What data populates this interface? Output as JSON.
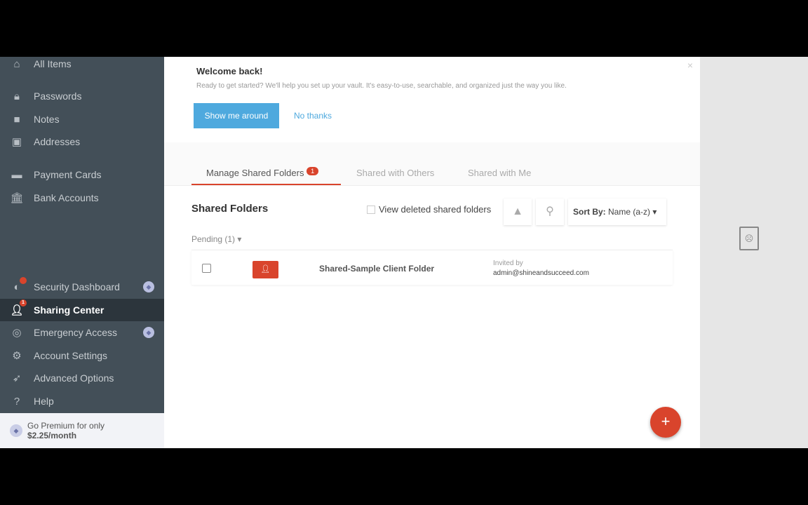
{
  "sidebar": {
    "items": [
      {
        "label": "All Items",
        "icon": "home-icon"
      },
      {
        "label": "Passwords",
        "icon": "lock-icon"
      },
      {
        "label": "Notes",
        "icon": "note-icon"
      },
      {
        "label": "Addresses",
        "icon": "address-icon"
      },
      {
        "label": "Payment Cards",
        "icon": "card-icon"
      },
      {
        "label": "Bank Accounts",
        "icon": "bank-icon"
      },
      {
        "label": "Security Dashboard",
        "icon": "shield-icon"
      },
      {
        "label": "Sharing Center",
        "icon": "sharing-icon",
        "badge": "1"
      },
      {
        "label": "Emergency Access",
        "icon": "lifebuoy-icon"
      },
      {
        "label": "Account Settings",
        "icon": "gear-icon"
      },
      {
        "label": "Advanced Options",
        "icon": "rocket-icon"
      },
      {
        "label": "Help",
        "icon": "help-icon"
      }
    ],
    "premium_line1": "Go Premium for only",
    "premium_price": "$2.25/month"
  },
  "welcome": {
    "title": "Welcome back!",
    "subtitle": "Ready to get started? We'll help you set up your vault. It's easy-to-use, searchable, and organized just the way you like.",
    "primary": "Show me around",
    "secondary": "No thanks"
  },
  "tabs": [
    {
      "label": "Manage Shared Folders",
      "badge": "1"
    },
    {
      "label": "Shared with Others"
    },
    {
      "label": "Shared with Me"
    }
  ],
  "section": {
    "title": "Shared Folders",
    "view_deleted": "View deleted shared folders",
    "sort_label": "Sort By:",
    "sort_value": "Name (a-z)",
    "pending": "Pending (1)"
  },
  "folder": {
    "name": "Shared-Sample Client Folder",
    "invited_label": "Invited by",
    "invited_email": "admin@shineandsucceed.com"
  },
  "colors": {
    "accent": "#d9442c",
    "blue": "#4ea9de",
    "sidebar": "#434f58"
  }
}
